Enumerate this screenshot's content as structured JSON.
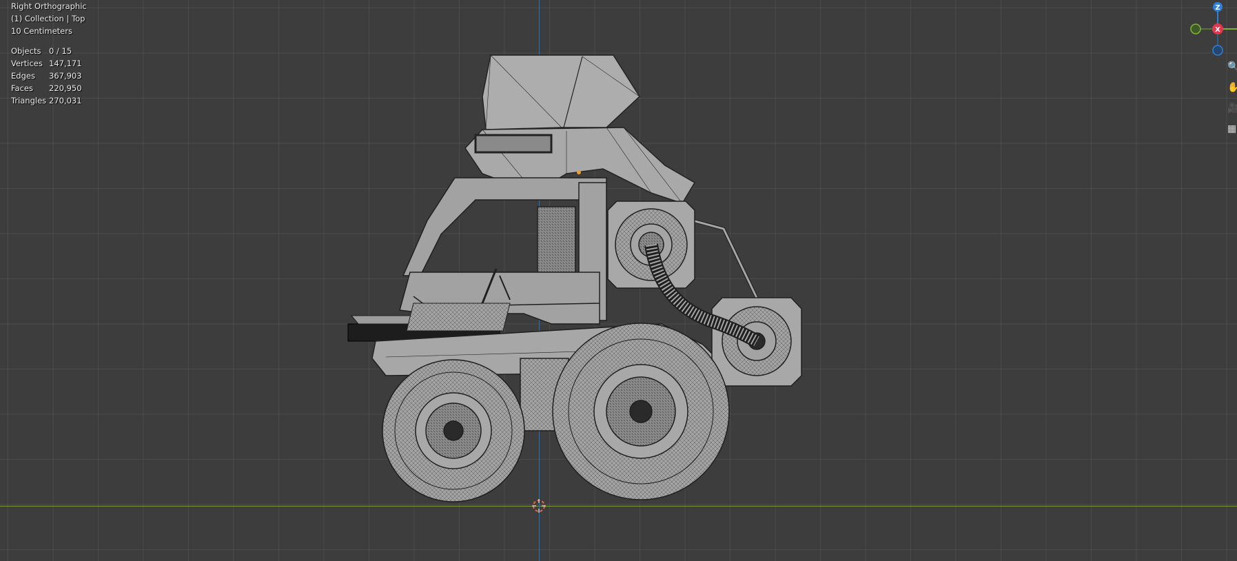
{
  "viewport": {
    "view_name": "Right Orthographic",
    "collection_line": "(1) Collection | Top",
    "grid_scale": "10 Centimeters"
  },
  "stats": [
    {
      "label": "Objects",
      "value": "0 / 15"
    },
    {
      "label": "Vertices",
      "value": "147,171"
    },
    {
      "label": "Edges",
      "value": "367,903"
    },
    {
      "label": "Faces",
      "value": "220,950"
    },
    {
      "label": "Triangles",
      "value": "270,031"
    }
  ],
  "gizmo": {
    "z_label": "Z",
    "x_label": "X",
    "z_color": "#2f80d8",
    "x_color": "#e2384f",
    "y_color": "#7fb438"
  },
  "nav_buttons": [
    {
      "icon": "zoom-icon"
    },
    {
      "icon": "hand-pan-icon"
    },
    {
      "icon": "camera-icon"
    },
    {
      "icon": "grid-perspective-icon"
    }
  ],
  "colors": {
    "background": "#3d3d3d",
    "grid_line": "#4a4a4a",
    "x_axis": "#7b9a32",
    "z_axis": "#3e6a9a",
    "mesh_fill": "#a8a8a8",
    "mesh_wire": "#2a2a2a"
  }
}
